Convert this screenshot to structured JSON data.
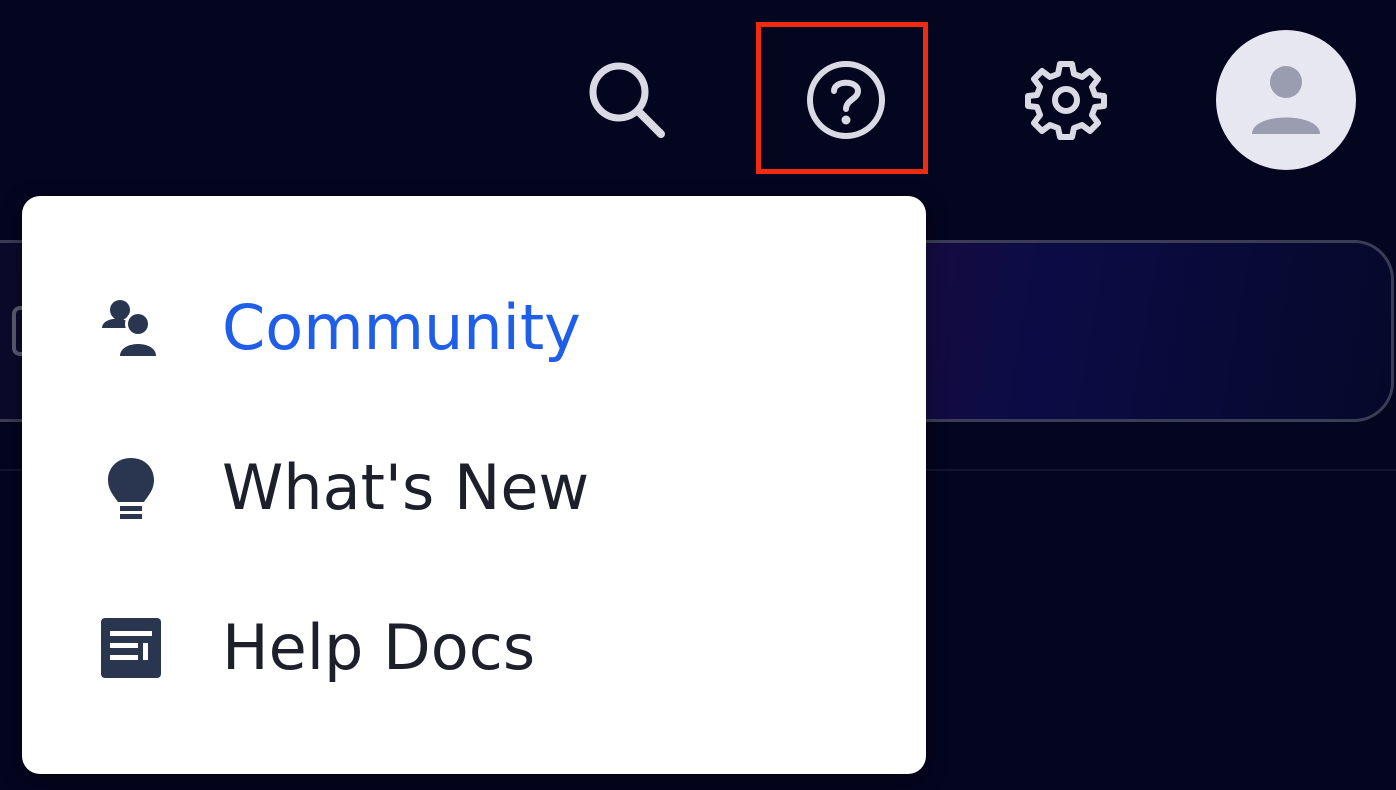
{
  "top_bar": {
    "icons": {
      "search": "search-icon",
      "help": "help-circle-icon",
      "settings": "gear-icon",
      "avatar": "user-avatar-icon"
    }
  },
  "help_menu": {
    "items": [
      {
        "label": "Community",
        "icon": "community-icon",
        "active": true
      },
      {
        "label": "What's New",
        "icon": "lightbulb-icon",
        "active": false
      },
      {
        "label": "Help Docs",
        "icon": "document-icon",
        "active": false
      }
    ]
  },
  "colors": {
    "background": "#04051f",
    "menu_background": "#ffffff",
    "active_link": "#1f5ee8",
    "text": "#1d1f2b",
    "icon_dark": "#2a3650",
    "top_icon": "#d9dae4",
    "highlight": "#f02b12",
    "avatar_bg": "#e6e7f0",
    "avatar_fg": "#9a9cb0"
  }
}
